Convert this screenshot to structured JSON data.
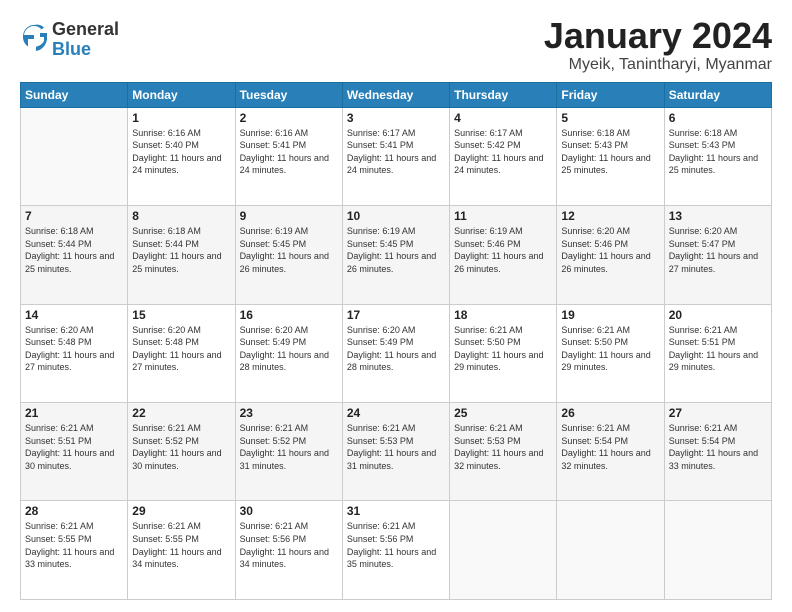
{
  "logo": {
    "general": "General",
    "blue": "Blue"
  },
  "title": "January 2024",
  "subtitle": "Myeik, Tanintharyi, Myanmar",
  "days_of_week": [
    "Sunday",
    "Monday",
    "Tuesday",
    "Wednesday",
    "Thursday",
    "Friday",
    "Saturday"
  ],
  "weeks": [
    [
      {
        "day": "",
        "sunrise": "",
        "sunset": "",
        "daylight": ""
      },
      {
        "day": "1",
        "sunrise": "Sunrise: 6:16 AM",
        "sunset": "Sunset: 5:40 PM",
        "daylight": "Daylight: 11 hours and 24 minutes."
      },
      {
        "day": "2",
        "sunrise": "Sunrise: 6:16 AM",
        "sunset": "Sunset: 5:41 PM",
        "daylight": "Daylight: 11 hours and 24 minutes."
      },
      {
        "day": "3",
        "sunrise": "Sunrise: 6:17 AM",
        "sunset": "Sunset: 5:41 PM",
        "daylight": "Daylight: 11 hours and 24 minutes."
      },
      {
        "day": "4",
        "sunrise": "Sunrise: 6:17 AM",
        "sunset": "Sunset: 5:42 PM",
        "daylight": "Daylight: 11 hours and 24 minutes."
      },
      {
        "day": "5",
        "sunrise": "Sunrise: 6:18 AM",
        "sunset": "Sunset: 5:43 PM",
        "daylight": "Daylight: 11 hours and 25 minutes."
      },
      {
        "day": "6",
        "sunrise": "Sunrise: 6:18 AM",
        "sunset": "Sunset: 5:43 PM",
        "daylight": "Daylight: 11 hours and 25 minutes."
      }
    ],
    [
      {
        "day": "7",
        "sunrise": "Sunrise: 6:18 AM",
        "sunset": "Sunset: 5:44 PM",
        "daylight": "Daylight: 11 hours and 25 minutes."
      },
      {
        "day": "8",
        "sunrise": "Sunrise: 6:18 AM",
        "sunset": "Sunset: 5:44 PM",
        "daylight": "Daylight: 11 hours and 25 minutes."
      },
      {
        "day": "9",
        "sunrise": "Sunrise: 6:19 AM",
        "sunset": "Sunset: 5:45 PM",
        "daylight": "Daylight: 11 hours and 26 minutes."
      },
      {
        "day": "10",
        "sunrise": "Sunrise: 6:19 AM",
        "sunset": "Sunset: 5:45 PM",
        "daylight": "Daylight: 11 hours and 26 minutes."
      },
      {
        "day": "11",
        "sunrise": "Sunrise: 6:19 AM",
        "sunset": "Sunset: 5:46 PM",
        "daylight": "Daylight: 11 hours and 26 minutes."
      },
      {
        "day": "12",
        "sunrise": "Sunrise: 6:20 AM",
        "sunset": "Sunset: 5:46 PM",
        "daylight": "Daylight: 11 hours and 26 minutes."
      },
      {
        "day": "13",
        "sunrise": "Sunrise: 6:20 AM",
        "sunset": "Sunset: 5:47 PM",
        "daylight": "Daylight: 11 hours and 27 minutes."
      }
    ],
    [
      {
        "day": "14",
        "sunrise": "Sunrise: 6:20 AM",
        "sunset": "Sunset: 5:48 PM",
        "daylight": "Daylight: 11 hours and 27 minutes."
      },
      {
        "day": "15",
        "sunrise": "Sunrise: 6:20 AM",
        "sunset": "Sunset: 5:48 PM",
        "daylight": "Daylight: 11 hours and 27 minutes."
      },
      {
        "day": "16",
        "sunrise": "Sunrise: 6:20 AM",
        "sunset": "Sunset: 5:49 PM",
        "daylight": "Daylight: 11 hours and 28 minutes."
      },
      {
        "day": "17",
        "sunrise": "Sunrise: 6:20 AM",
        "sunset": "Sunset: 5:49 PM",
        "daylight": "Daylight: 11 hours and 28 minutes."
      },
      {
        "day": "18",
        "sunrise": "Sunrise: 6:21 AM",
        "sunset": "Sunset: 5:50 PM",
        "daylight": "Daylight: 11 hours and 29 minutes."
      },
      {
        "day": "19",
        "sunrise": "Sunrise: 6:21 AM",
        "sunset": "Sunset: 5:50 PM",
        "daylight": "Daylight: 11 hours and 29 minutes."
      },
      {
        "day": "20",
        "sunrise": "Sunrise: 6:21 AM",
        "sunset": "Sunset: 5:51 PM",
        "daylight": "Daylight: 11 hours and 29 minutes."
      }
    ],
    [
      {
        "day": "21",
        "sunrise": "Sunrise: 6:21 AM",
        "sunset": "Sunset: 5:51 PM",
        "daylight": "Daylight: 11 hours and 30 minutes."
      },
      {
        "day": "22",
        "sunrise": "Sunrise: 6:21 AM",
        "sunset": "Sunset: 5:52 PM",
        "daylight": "Daylight: 11 hours and 30 minutes."
      },
      {
        "day": "23",
        "sunrise": "Sunrise: 6:21 AM",
        "sunset": "Sunset: 5:52 PM",
        "daylight": "Daylight: 11 hours and 31 minutes."
      },
      {
        "day": "24",
        "sunrise": "Sunrise: 6:21 AM",
        "sunset": "Sunset: 5:53 PM",
        "daylight": "Daylight: 11 hours and 31 minutes."
      },
      {
        "day": "25",
        "sunrise": "Sunrise: 6:21 AM",
        "sunset": "Sunset: 5:53 PM",
        "daylight": "Daylight: 11 hours and 32 minutes."
      },
      {
        "day": "26",
        "sunrise": "Sunrise: 6:21 AM",
        "sunset": "Sunset: 5:54 PM",
        "daylight": "Daylight: 11 hours and 32 minutes."
      },
      {
        "day": "27",
        "sunrise": "Sunrise: 6:21 AM",
        "sunset": "Sunset: 5:54 PM",
        "daylight": "Daylight: 11 hours and 33 minutes."
      }
    ],
    [
      {
        "day": "28",
        "sunrise": "Sunrise: 6:21 AM",
        "sunset": "Sunset: 5:55 PM",
        "daylight": "Daylight: 11 hours and 33 minutes."
      },
      {
        "day": "29",
        "sunrise": "Sunrise: 6:21 AM",
        "sunset": "Sunset: 5:55 PM",
        "daylight": "Daylight: 11 hours and 34 minutes."
      },
      {
        "day": "30",
        "sunrise": "Sunrise: 6:21 AM",
        "sunset": "Sunset: 5:56 PM",
        "daylight": "Daylight: 11 hours and 34 minutes."
      },
      {
        "day": "31",
        "sunrise": "Sunrise: 6:21 AM",
        "sunset": "Sunset: 5:56 PM",
        "daylight": "Daylight: 11 hours and 35 minutes."
      },
      {
        "day": "",
        "sunrise": "",
        "sunset": "",
        "daylight": ""
      },
      {
        "day": "",
        "sunrise": "",
        "sunset": "",
        "daylight": ""
      },
      {
        "day": "",
        "sunrise": "",
        "sunset": "",
        "daylight": ""
      }
    ]
  ]
}
